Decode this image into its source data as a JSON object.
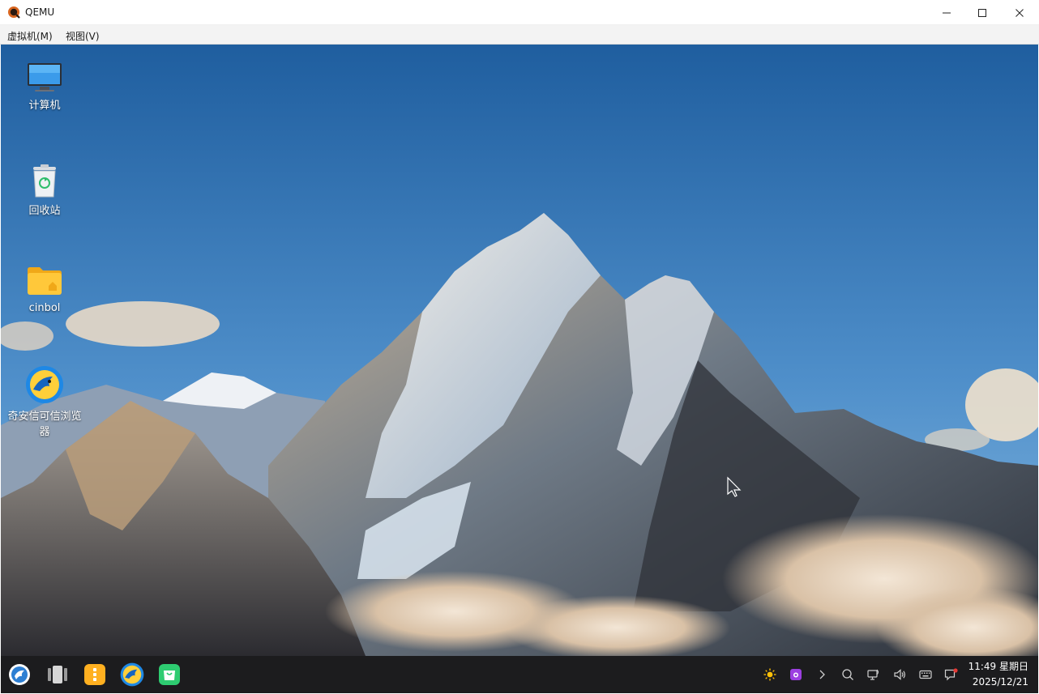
{
  "window": {
    "title": "QEMU",
    "controls": [
      "minimize-icon",
      "maximize-icon",
      "close-icon"
    ]
  },
  "menubar": {
    "vm_label": "虚拟机(M)",
    "view_label": "视图(V)"
  },
  "desktop": {
    "icons": [
      {
        "label": "计算机",
        "icon": "computer-icon"
      },
      {
        "label": "回收站",
        "icon": "recycle-bin-icon"
      },
      {
        "label": "cinbol",
        "icon": "home-folder-icon"
      },
      {
        "label": "奇安信可信浏览器",
        "icon": "qianxin-browser-icon"
      }
    ]
  },
  "taskbar": {
    "apps": [
      "start-menu-icon",
      "multitask-view-icon",
      "file-manager-icon",
      "qianxin-browser-icon",
      "app-store-icon"
    ],
    "tray": [
      "brightness-icon",
      "screenshot-icon",
      "expand-tray-icon",
      "search-icon",
      "network-icon",
      "volume-icon",
      "keyboard-icon",
      "notification-icon"
    ],
    "clock": {
      "time": "11:49 星期日",
      "date": "2025/12/21"
    }
  },
  "colors": {
    "sky_top": "#1f5e9f",
    "sky_bottom": "#7fb3de",
    "taskbar": "#1c1c1e",
    "notification_dot": "#e53935",
    "app_store_green": "#2ecc71"
  }
}
